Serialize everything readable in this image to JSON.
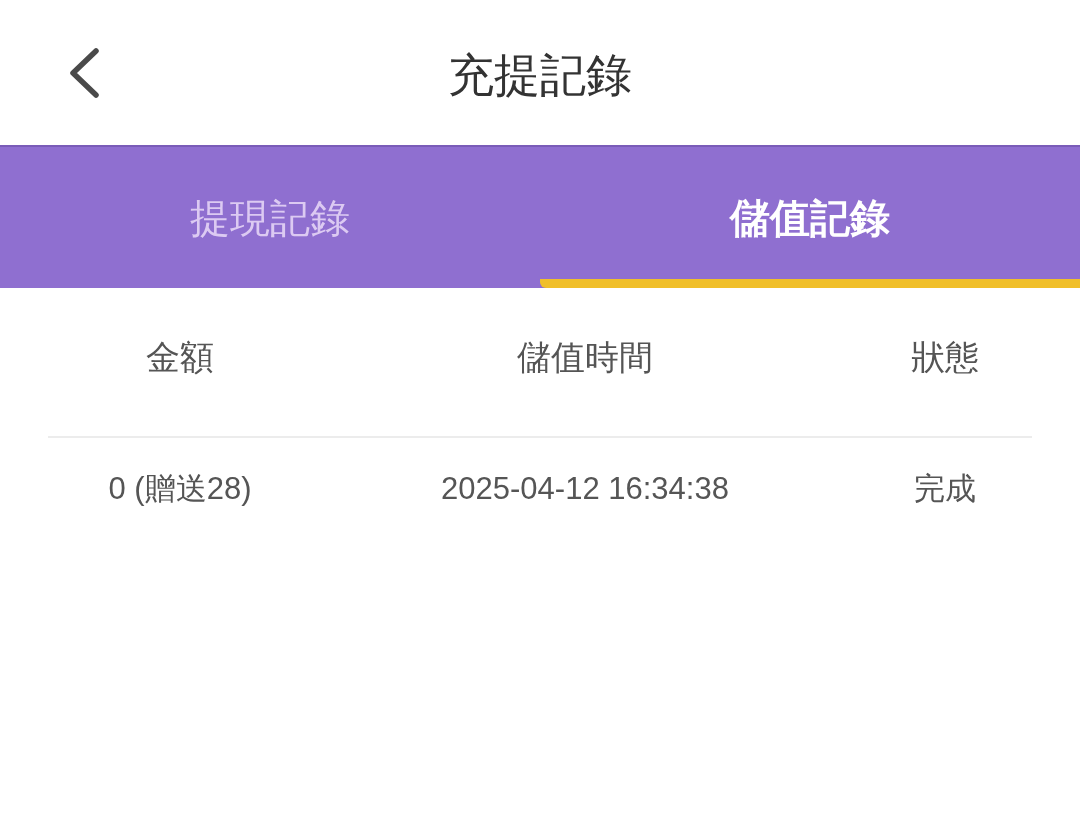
{
  "header": {
    "title": "充提記錄"
  },
  "tabs": [
    {
      "label": "提現記錄",
      "selected": false
    },
    {
      "label": "儲值記錄",
      "selected": true
    }
  ],
  "table": {
    "columns": [
      "金額",
      "儲值時間",
      "狀態"
    ],
    "rows": [
      {
        "cells": [
          "0 (贈送28)",
          "2025-04-12 16:34:38",
          "完成"
        ]
      }
    ]
  }
}
